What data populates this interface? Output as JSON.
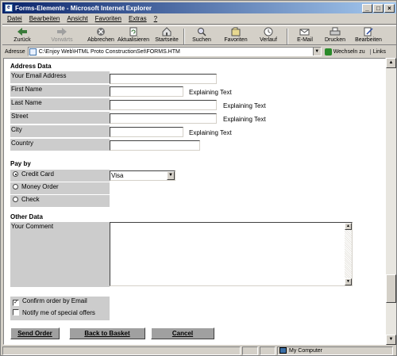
{
  "window": {
    "title": "Forms-Elemente - Microsoft Internet Explorer"
  },
  "menu": [
    "Datei",
    "Bearbeiten",
    "Ansicht",
    "Favoriten",
    "Extras",
    "?"
  ],
  "toolbar": {
    "back": "Zurück",
    "forward": "Vorwärts",
    "stop": "Abbrechen",
    "refresh": "Aktualisieren",
    "home": "Startseite",
    "search": "Suchen",
    "favorites": "Favoriten",
    "history": "Verlauf",
    "mail": "E-Mail",
    "print": "Drucken",
    "edit": "Bearbeiten"
  },
  "address": {
    "label": "Adresse",
    "url": "C:\\Enjoy Web\\HTML Proto ConstructionSet\\FORMS.HTM",
    "go": "Wechseln zu",
    "links": "Links"
  },
  "form": {
    "address_title": "Address Data",
    "fields": {
      "email": "Your Email Address",
      "first_name": "First Name",
      "last_name": "Last Name",
      "street": "Street",
      "city": "City",
      "country": "Country"
    },
    "explaining_text": "Explaining Text",
    "payby_title": "Pay by",
    "payment_options": [
      "Credit Card",
      "Money Order",
      "Check"
    ],
    "card_selected": "Visa",
    "other_title": "Other Data",
    "comment_label": "Your Comment",
    "confirm_email": "Confirm order by Email",
    "notify_offers": "Notify me of special offers",
    "buttons": {
      "send": "Send Order",
      "back": "Back to Basket",
      "cancel": "Cancel"
    }
  },
  "status": {
    "zone": "My Computer"
  }
}
